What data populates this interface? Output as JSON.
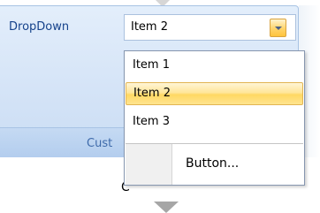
{
  "ribbon": {
    "group_caption": "Cust",
    "below_text": "C"
  },
  "dropdown": {
    "label": "DropDown",
    "value": "Item 2",
    "arrow_icon": "chevron-down-icon"
  },
  "popup": {
    "items": [
      {
        "label": "Item 1",
        "selected": false
      },
      {
        "label": "Item 2",
        "selected": true
      },
      {
        "label": "Item 3",
        "selected": false
      }
    ],
    "button_label": "Button..."
  },
  "colors": {
    "ribbon_text": "#15428b",
    "highlight": "#ffd863",
    "highlight_border": "#e2b553"
  }
}
